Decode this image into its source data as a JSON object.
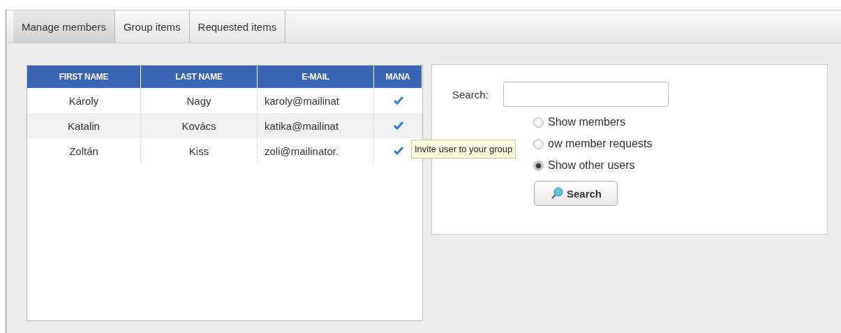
{
  "tabs": [
    {
      "label": "Manage members",
      "selected": true
    },
    {
      "label": "Group items",
      "selected": false
    },
    {
      "label": "Requested items",
      "selected": false
    }
  ],
  "table": {
    "columns": [
      "FIRST NAME",
      "LAST NAME",
      "E-MAIL",
      "MANA"
    ],
    "rows": [
      {
        "first_name": "Károly",
        "last_name": "Nagy",
        "email": "karoly@mailinat",
        "manager": true
      },
      {
        "first_name": "Katalin",
        "last_name": "Kovács",
        "email": "katika@mailinat",
        "manager": true
      },
      {
        "first_name": "Zoltán",
        "last_name": "Kiss",
        "email": "zoli@mailinator.",
        "manager": true
      }
    ]
  },
  "search_panel": {
    "label": "Search:",
    "options": [
      {
        "label": "Show members",
        "selected": false
      },
      {
        "label": "ow member requests",
        "selected": false
      },
      {
        "label": "Show other users",
        "selected": true
      }
    ],
    "button": "Search"
  },
  "tooltip": "Invite user to your group"
}
